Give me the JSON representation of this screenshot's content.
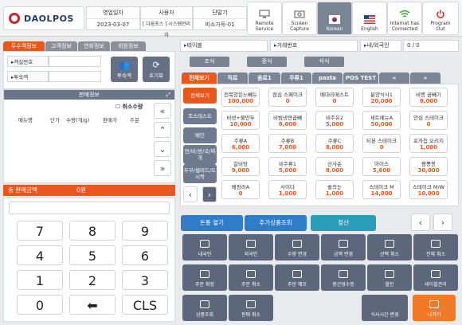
{
  "header": {
    "logo": "DAOLPOS",
    "info": [
      {
        "label": "영업일자",
        "value": "2023-03-07"
      },
      {
        "label": "사용자",
        "value": "[ 다움포스 ] 시스템관리자"
      },
      {
        "label": "단말기",
        "value": "미소가득-01"
      }
    ],
    "buttons": [
      {
        "label": "Remote\nService",
        "icon": "monitor-icon"
      },
      {
        "label": "Screen\nCapture",
        "icon": "camera-icon"
      },
      {
        "label": "Korean",
        "icon": "korea-flag-icon"
      },
      {
        "label": "English",
        "icon": "usa-flag-icon"
      },
      {
        "label": "Internet has\nConnected",
        "icon": "wifi-icon"
      },
      {
        "label": "Program\nOut",
        "icon": "power-icon"
      }
    ]
  },
  "left": {
    "tabs": [
      "두수객정보",
      "고객정보",
      "연회정보",
      "회원정보"
    ],
    "fields": [
      {
        "label": "▸객실번호"
      },
      {
        "label": "▸투숙객"
      }
    ],
    "btn_guest": "투숙객",
    "btn_reset": "초기화",
    "sales": {
      "title": "판매정보",
      "cancel_qty": "취소수량",
      "cols": [
        "메뉴명",
        "단가",
        "수량(개/g)",
        "판매가",
        "주문"
      ]
    },
    "total_label": "총 판매금액",
    "total_value": "0원",
    "keys": [
      "7",
      "8",
      "9",
      "4",
      "5",
      "6",
      "1",
      "2",
      "3",
      "0",
      "⬅",
      "CLS"
    ]
  },
  "right": {
    "fields": [
      {
        "label": "▸테이블"
      },
      {
        "label": "▸거래번호"
      },
      {
        "label": "▸내/외국인",
        "value": "0 / 0"
      }
    ],
    "meals": [
      "조식",
      "중식",
      "석식"
    ],
    "menu_tabs": [
      "전체보기",
      "직료",
      "음료1",
      "주류1",
      "pasta",
      "POS TEST",
      "«",
      "»"
    ],
    "side": [
      "전체보기",
      "조스테스트",
      "배인",
      "연/비/쌍/국/찌개",
      "두부/샐러드/도시락"
    ],
    "items": [
      [
        "전복양된느빼뉴",
        "100,000"
      ],
      [
        "점심 스페이크",
        "0"
      ],
      [
        "배대리메스트",
        "0"
      ],
      [
        "분양식사1",
        "20,000"
      ],
      [
        "비병 곰빼기",
        "8,000"
      ],
      [
        "비냉+물만두",
        "10,000"
      ],
      [
        "비빔냉면곱빼",
        "8,000"
      ],
      [
        "비주유2",
        "5,000"
      ],
      [
        "세트메뉴A",
        "50,000"
      ],
      [
        "안심 스테이크",
        "0"
      ],
      [
        "주류A",
        "6,000"
      ],
      [
        "주류B",
        "7,000"
      ],
      [
        "주류C",
        "8,000"
      ],
      [
        "티본 스테이크",
        "0"
      ],
      [
        "포카칩 오리지",
        "1,000"
      ],
      [
        "갈비탕",
        "9,000"
      ],
      [
        "비주류1",
        "5,000"
      ],
      [
        "산사춘",
        "8,000"
      ],
      [
        "아이스",
        "5,600"
      ],
      [
        "짬뽕봉",
        "30,000"
      ],
      [
        "봬핑라A",
        "0"
      ],
      [
        "사이다",
        "1,000"
      ],
      [
        "솔의눈",
        "1,000"
      ],
      [
        "스테이크 M",
        "14,800"
      ],
      [
        "스테이크 M/W",
        "10,000"
      ]
    ],
    "actions": [
      "돈통 열기",
      "추가상품조회",
      "정산"
    ],
    "fns": [
      [
        "내국인",
        "user-icon"
      ],
      [
        "외국인",
        "foreigner-icon"
      ],
      [
        "수량 변경",
        "qty-icon"
      ],
      [
        "금액 변경",
        "lock-icon"
      ],
      [
        "선택 취소",
        "select-cancel-icon"
      ],
      [
        "전체 취소",
        "doc-cancel-icon"
      ],
      [
        "주문 확정",
        "confirm-icon"
      ],
      [
        "주문 취소",
        "order-cancel-icon"
      ],
      [
        "주방 메모",
        "memo-icon"
      ],
      [
        "중간영수증",
        "receipt-icon"
      ],
      [
        "할인",
        "tag-icon"
      ],
      [
        "테이블관리",
        "table-icon"
      ],
      [
        "상품조회",
        "search-icon"
      ],
      [
        "판매 취소",
        "sale-cancel-icon"
      ]
    ],
    "btn_time": "식사시간 변경",
    "btn_exit": "나가기"
  },
  "colors": {
    "accent": "#e8581c",
    "dark": "#5c677b",
    "blue": "#2f7cc9",
    "teal": "#2a9db8"
  }
}
